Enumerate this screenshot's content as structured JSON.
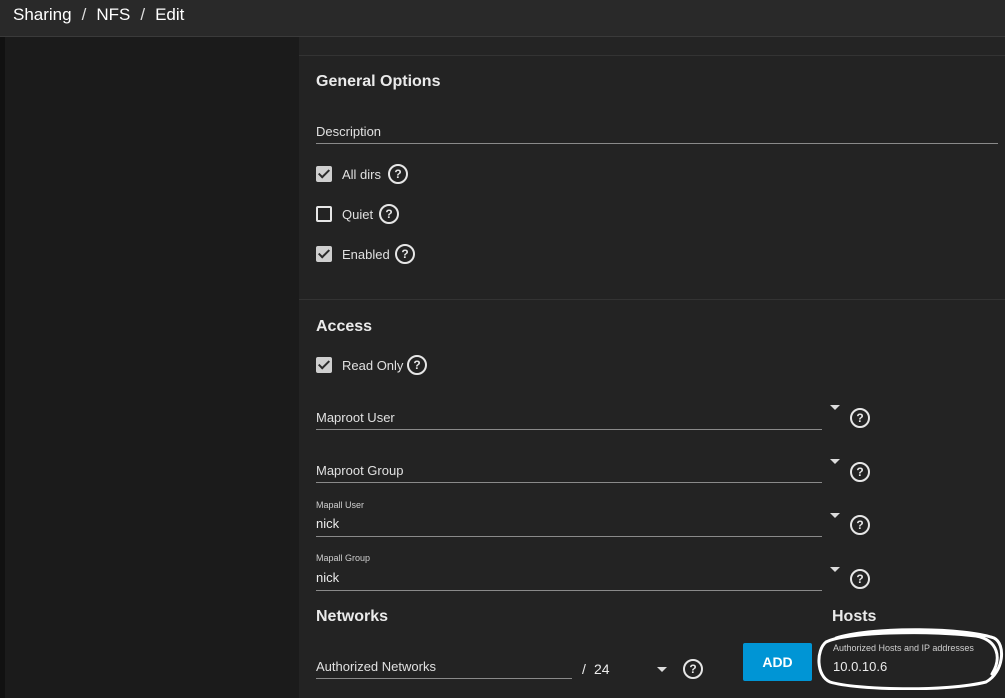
{
  "breadcrumb": [
    "Sharing",
    "NFS",
    "Edit"
  ],
  "general": {
    "title": "General Options",
    "description_label": "Description",
    "options": [
      {
        "label": "All dirs",
        "checked": true
      },
      {
        "label": "Quiet",
        "checked": false
      },
      {
        "label": "Enabled",
        "checked": true
      }
    ]
  },
  "access": {
    "title": "Access",
    "read_only": {
      "label": "Read Only",
      "checked": true
    },
    "maproot_user": {
      "label": "Maproot User",
      "value": ""
    },
    "maproot_group": {
      "label": "Maproot Group",
      "value": ""
    },
    "mapall_user": {
      "label": "Mapall User",
      "value": "nick"
    },
    "mapall_group": {
      "label": "Mapall Group",
      "value": "nick"
    }
  },
  "networks": {
    "title": "Networks",
    "authorized_label": "Authorized Networks",
    "mask": "24",
    "mask_sep": "/",
    "add_label": "ADD"
  },
  "hosts": {
    "title": "Hosts",
    "field_label": "Authorized Hosts and IP addresses",
    "value": "10.0.10.6"
  },
  "help_glyph": "?"
}
